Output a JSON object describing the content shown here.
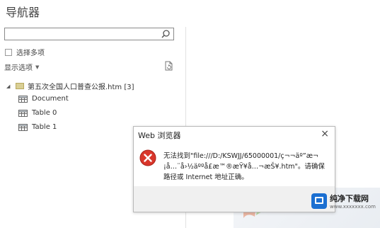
{
  "navigator": {
    "title": "导航器",
    "search": {
      "value": "",
      "placeholder": ""
    },
    "multi_select_label": "选择多项",
    "display_options_label": "显示选项",
    "tree": {
      "root_label": "第五次全国人口普查公报.htm [3]",
      "items": [
        {
          "label": "Document",
          "icon": "table-icon"
        },
        {
          "label": "Table 0",
          "icon": "table-icon"
        },
        {
          "label": "Table 1",
          "icon": "table-icon"
        }
      ]
    }
  },
  "dialog": {
    "title": "Web 浏览器",
    "close_label": "×",
    "message": "无法找到\"file:///D:/KSWJJ/65000001/ç¬¬äº”æ¬¡å…¨å›½äººå£æ™®æŸ¥å…¬æŠ¥.htm\"。请确保路径或 Internet 地址正确。",
    "icon": "error-icon"
  },
  "watermark": {
    "title": "纯净下载网",
    "url": "www.xxxxxxx.com"
  },
  "colors": {
    "dialog_footer": "#f0f0f0",
    "error_red": "#d9362b",
    "folder": "#d9cf95",
    "brand_blue": "#1b6fd1"
  }
}
